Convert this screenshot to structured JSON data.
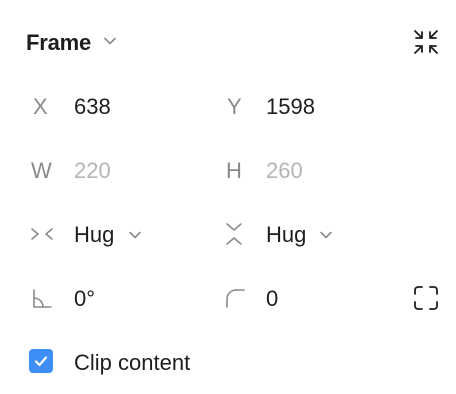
{
  "header": {
    "title": "Frame",
    "title_icon": "chevron-down-icon",
    "collapse_icon": "collapse-arrows-icon"
  },
  "position": {
    "x_label": "X",
    "x_value": "638",
    "y_label": "Y",
    "y_value": "1598"
  },
  "size": {
    "w_label": "W",
    "w_value": "220",
    "h_label": "H",
    "h_value": "260"
  },
  "resizing": {
    "horizontal_icon": "hug-horizontal-icon",
    "horizontal_value": "Hug",
    "vertical_icon": "hug-vertical-icon",
    "vertical_value": "Hug"
  },
  "transform": {
    "rotation_icon": "rotation-angle-icon",
    "rotation_value": "0°",
    "radius_icon": "corner-radius-icon",
    "radius_value": "0",
    "independent_corners_icon": "independent-corners-icon"
  },
  "clip": {
    "checked": true,
    "label": "Clip content"
  },
  "colors": {
    "checkbox": "#3d8ef7",
    "text": "#1e1e1e",
    "label": "#8a8a8a",
    "muted": "#b5b5b5"
  }
}
